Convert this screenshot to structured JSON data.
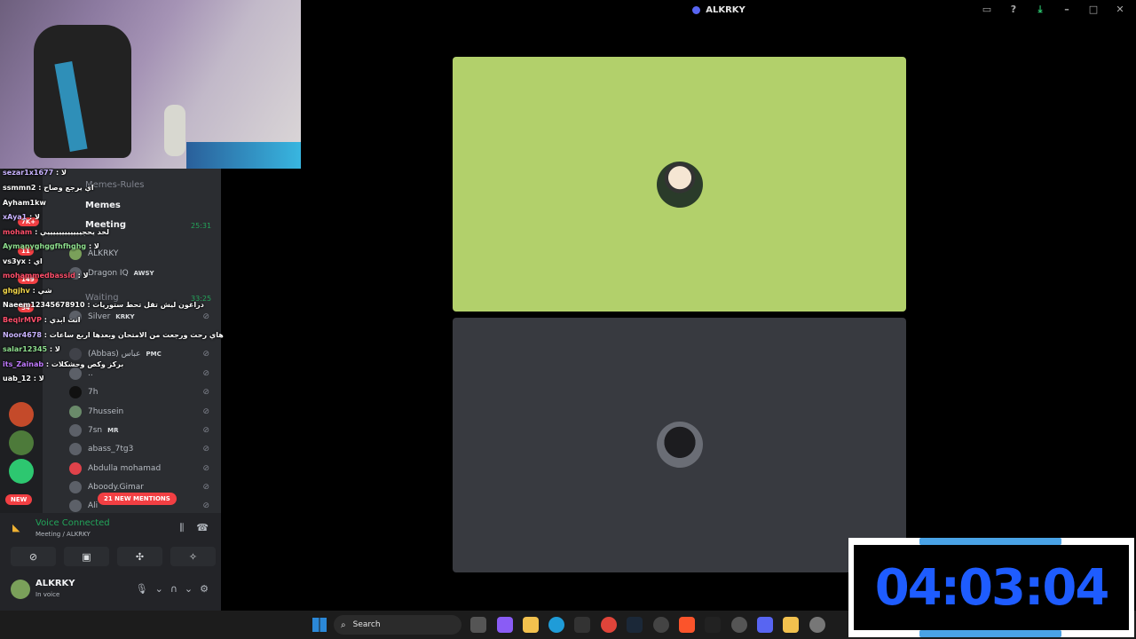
{
  "window": {
    "title": "ALKRKY"
  },
  "titlebar_icons": [
    "screen-share-icon",
    "help-icon",
    "download-icon",
    "minimize-icon",
    "maximize-icon",
    "close-icon"
  ],
  "channels": {
    "memes_rules": "Memes-Rules",
    "memes": "Memes",
    "meeting": "Meeting",
    "meeting_timer": "25:31",
    "waiting": "Waiting",
    "waiting_timer": "33:25"
  },
  "meeting_users": [
    {
      "name": "ALKRKY",
      "tag": ""
    },
    {
      "name": "Dragon IQ",
      "tag": "AWSY"
    }
  ],
  "waiting_users": [
    {
      "name": "Silver",
      "tag": "KRKY"
    },
    {
      "name": "(Abbas) عباس",
      "tag": "PMC"
    },
    {
      "name": "..",
      "tag": ""
    },
    {
      "name": "7h",
      "tag": ""
    },
    {
      "name": "7hussein",
      "tag": ""
    },
    {
      "name": "7sn",
      "tag": "MR"
    },
    {
      "name": "abass_7tg3",
      "tag": ""
    },
    {
      "name": "Abdulla mohamad",
      "tag": ""
    },
    {
      "name": "Aboody.Gimar",
      "tag": ""
    },
    {
      "name": "Ali",
      "tag": ""
    }
  ],
  "guild_badges": [
    "7K+",
    "11",
    "149",
    "54"
  ],
  "new_badge": "NEW",
  "mentions_pill": "21 NEW MENTIONS",
  "voice": {
    "status": "Voice Connected",
    "location": "Meeting / ALKRKY"
  },
  "user": {
    "name": "ALKRKY",
    "status": "In voice"
  },
  "chat": [
    {
      "user": "sezar1x1677",
      "msg": ": لا",
      "color": "#c9b3ff"
    },
    {
      "user": "ssmmn2",
      "msg": ": اي يرجع وصاح",
      "color": "#ffffff"
    },
    {
      "user": "Ayham1kw",
      "msg": "",
      "color": "#ffffff"
    },
    {
      "user": "xAya1",
      "msg": ": لا",
      "color": "#c9b3ff"
    },
    {
      "user": "moham",
      "msg": ": لخد يحجييييييييييييي",
      "color": "#ff4f6b"
    },
    {
      "user": "Aymanyghggfhfhghg",
      "msg": ": لا",
      "color": "#8fe08f"
    },
    {
      "user": "vs3yx",
      "msg": ": اي",
      "color": "#ffffff"
    },
    {
      "user": "mohammedbassid",
      "msg": ": لا",
      "color": "#ff4f6b"
    },
    {
      "user": "ghgjhv",
      "msg": ": شي",
      "color": "#f5d84a"
    },
    {
      "user": "Naeem12345678910",
      "msg": ": دراغون ليش تقل تحط ستوريات",
      "color": "#ffffff"
    },
    {
      "user": "BeqlrMVP",
      "msg": ": انت ابدي",
      "color": "#ff4f6b"
    },
    {
      "user": "Noor4678",
      "msg": ": هاي رحت ورجعت من الامتحان وبعدها اربع ساعات",
      "color": "#c9b3ff"
    },
    {
      "user": "salar12345",
      "msg": ": لا",
      "color": "#8fe08f"
    },
    {
      "user": "its_Zainab",
      "msg": ": بركز وكص وحشكلات",
      "color": "#c07aff"
    },
    {
      "user": "uab_12",
      "msg": ": لا",
      "color": "#ffffff"
    }
  ],
  "taskbar": {
    "search_label": "Search"
  },
  "clock": {
    "time": "04:03:04"
  },
  "colors": {
    "tile_top": "#b2d06b",
    "tile_bottom": "#383a40",
    "accent": "#5865f2",
    "clock": "#1e5cff"
  }
}
